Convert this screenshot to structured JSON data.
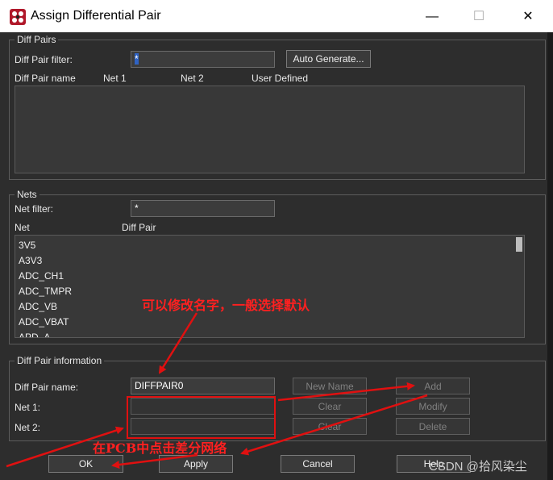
{
  "window": {
    "title": "Assign Differential Pair",
    "minimize": "—",
    "maximize": "☐",
    "close": "✕"
  },
  "diff_pairs": {
    "legend": "Diff Pairs",
    "filter_label": "Diff Pair filter:",
    "filter_value": "*",
    "auto_generate": "Auto Generate...",
    "columns": [
      "Diff Pair name",
      "Net 1",
      "Net 2",
      "User Defined"
    ]
  },
  "nets": {
    "legend": "Nets",
    "filter_label": "Net filter:",
    "filter_value": "*",
    "columns": [
      "Net",
      "Diff Pair"
    ],
    "items": [
      "3V5",
      "A3V3",
      "ADC_CH1",
      "ADC_TMPR",
      "ADC_VB",
      "ADC_VBAT",
      "APD_A"
    ]
  },
  "info": {
    "legend": "Diff Pair information",
    "name_label": "Diff Pair name:",
    "name_value": "DIFFPAIR0",
    "net1_label": "Net 1:",
    "net2_label": "Net 2:",
    "new_name": "New Name",
    "add": "Add",
    "clear1": "Clear",
    "modify": "Modify",
    "clear2": "Clear",
    "delete": "Delete"
  },
  "footer": {
    "ok": "OK",
    "apply": "Apply",
    "cancel": "Cancel",
    "help": "Help"
  },
  "annotations": {
    "rename": "可以修改名字，一般选择默认",
    "click_nets": "在PCB中点击差分网络"
  },
  "watermark": "CSDN @拾风染尘",
  "colors": {
    "annotation_red": "#e01010",
    "dialog_bg": "#2d2d2d"
  }
}
